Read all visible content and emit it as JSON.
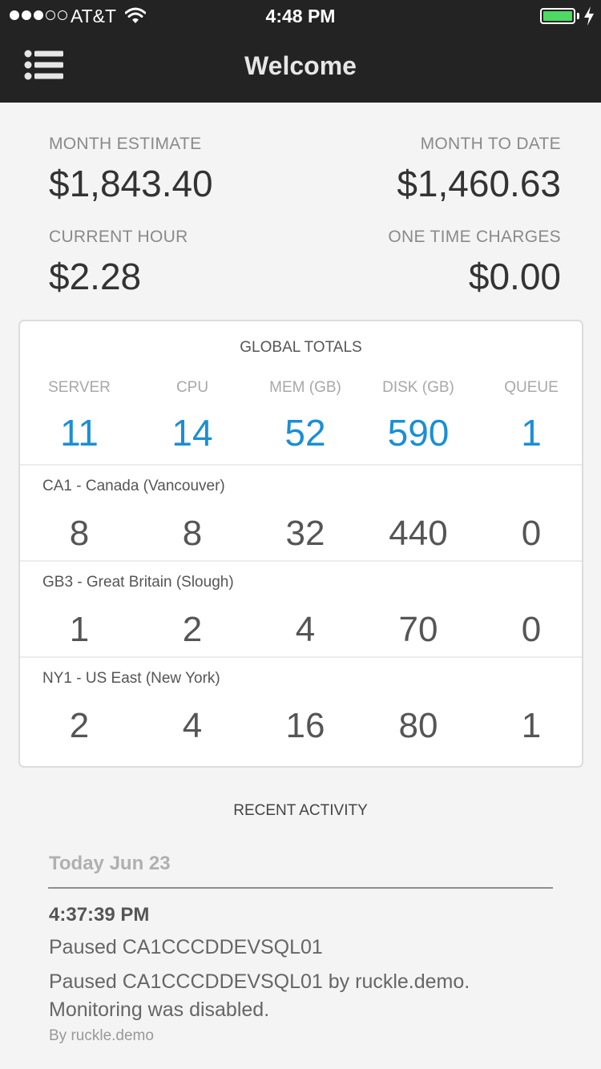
{
  "status_bar": {
    "carrier": "AT&T",
    "time": "4:48 PM",
    "battery_color": "#4cd964"
  },
  "nav": {
    "menu_icon": "list-menu-icon",
    "title": "Welcome"
  },
  "billing": {
    "month_estimate": {
      "label": "MONTH ESTIMATE",
      "value": "$1,843.40"
    },
    "month_to_date": {
      "label": "MONTH TO DATE",
      "value": "$1,460.63"
    },
    "current_hour": {
      "label": "CURRENT HOUR",
      "value": "$2.28"
    },
    "one_time_charges": {
      "label": "ONE TIME CHARGES",
      "value": "$0.00"
    }
  },
  "global_totals": {
    "title": "GLOBAL TOTALS",
    "columns": [
      "SERVER",
      "CPU",
      "MEM (GB)",
      "DISK (GB)",
      "QUEUE"
    ],
    "totals": [
      "11",
      "14",
      "52",
      "590",
      "1"
    ],
    "accent_color": "#1a8fd4",
    "regions": [
      {
        "name": "CA1 - Canada (Vancouver)",
        "values": [
          "8",
          "8",
          "32",
          "440",
          "0"
        ]
      },
      {
        "name": "GB3 - Great Britain (Slough)",
        "values": [
          "1",
          "2",
          "4",
          "70",
          "0"
        ]
      },
      {
        "name": "NY1 - US East (New York)",
        "values": [
          "2",
          "4",
          "16",
          "80",
          "1"
        ]
      }
    ]
  },
  "recent_activity": {
    "title": "RECENT ACTIVITY",
    "date_header": "Today Jun 23",
    "items": [
      {
        "time": "4:37:39 PM",
        "title": "Paused CA1CCCDDEVSQL01",
        "description": "Paused CA1CCCDDEVSQL01 by ruckle.demo. Monitoring was disabled.",
        "by": "By ruckle.demo"
      }
    ]
  }
}
